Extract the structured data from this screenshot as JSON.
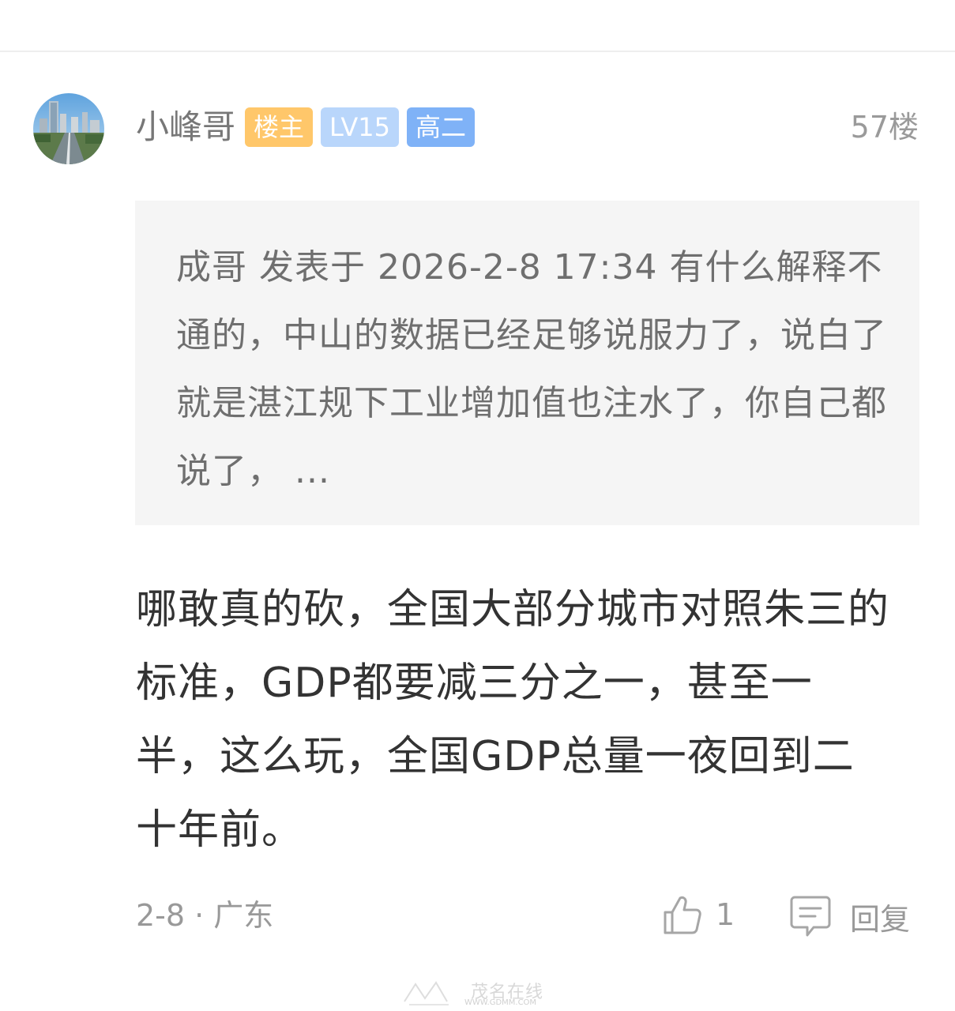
{
  "post": {
    "username": "小峰哥",
    "badges": [
      {
        "label": "楼主",
        "color": "#ffc76a"
      },
      {
        "label": "LV15",
        "color": "#b9d6fb"
      },
      {
        "label": "高二",
        "color": "#7fb2f7"
      }
    ],
    "floor": "57楼",
    "quote": "成哥 发表于 2026-2-8 17:34 有什么解释不通的，中山的数据已经足够说服力了，说白了就是湛江规下工业增加值也注水了，你自己都说了， ...",
    "content": "哪敢真的砍，全国大部分城市对照朱三的标准，GDP都要减三分之一，甚至一半，这么玩，全国GDP总量一夜回到二十年前。",
    "meta": "2-8 · 广东",
    "like_count": "1",
    "reply_label": "回复"
  },
  "watermark": {
    "text": "茂名在线",
    "url": "WWW.GDMM.COM"
  },
  "icons": {
    "like": "thumbs-up-icon",
    "reply": "comment-icon",
    "avatar": "city-skyline-avatar"
  }
}
